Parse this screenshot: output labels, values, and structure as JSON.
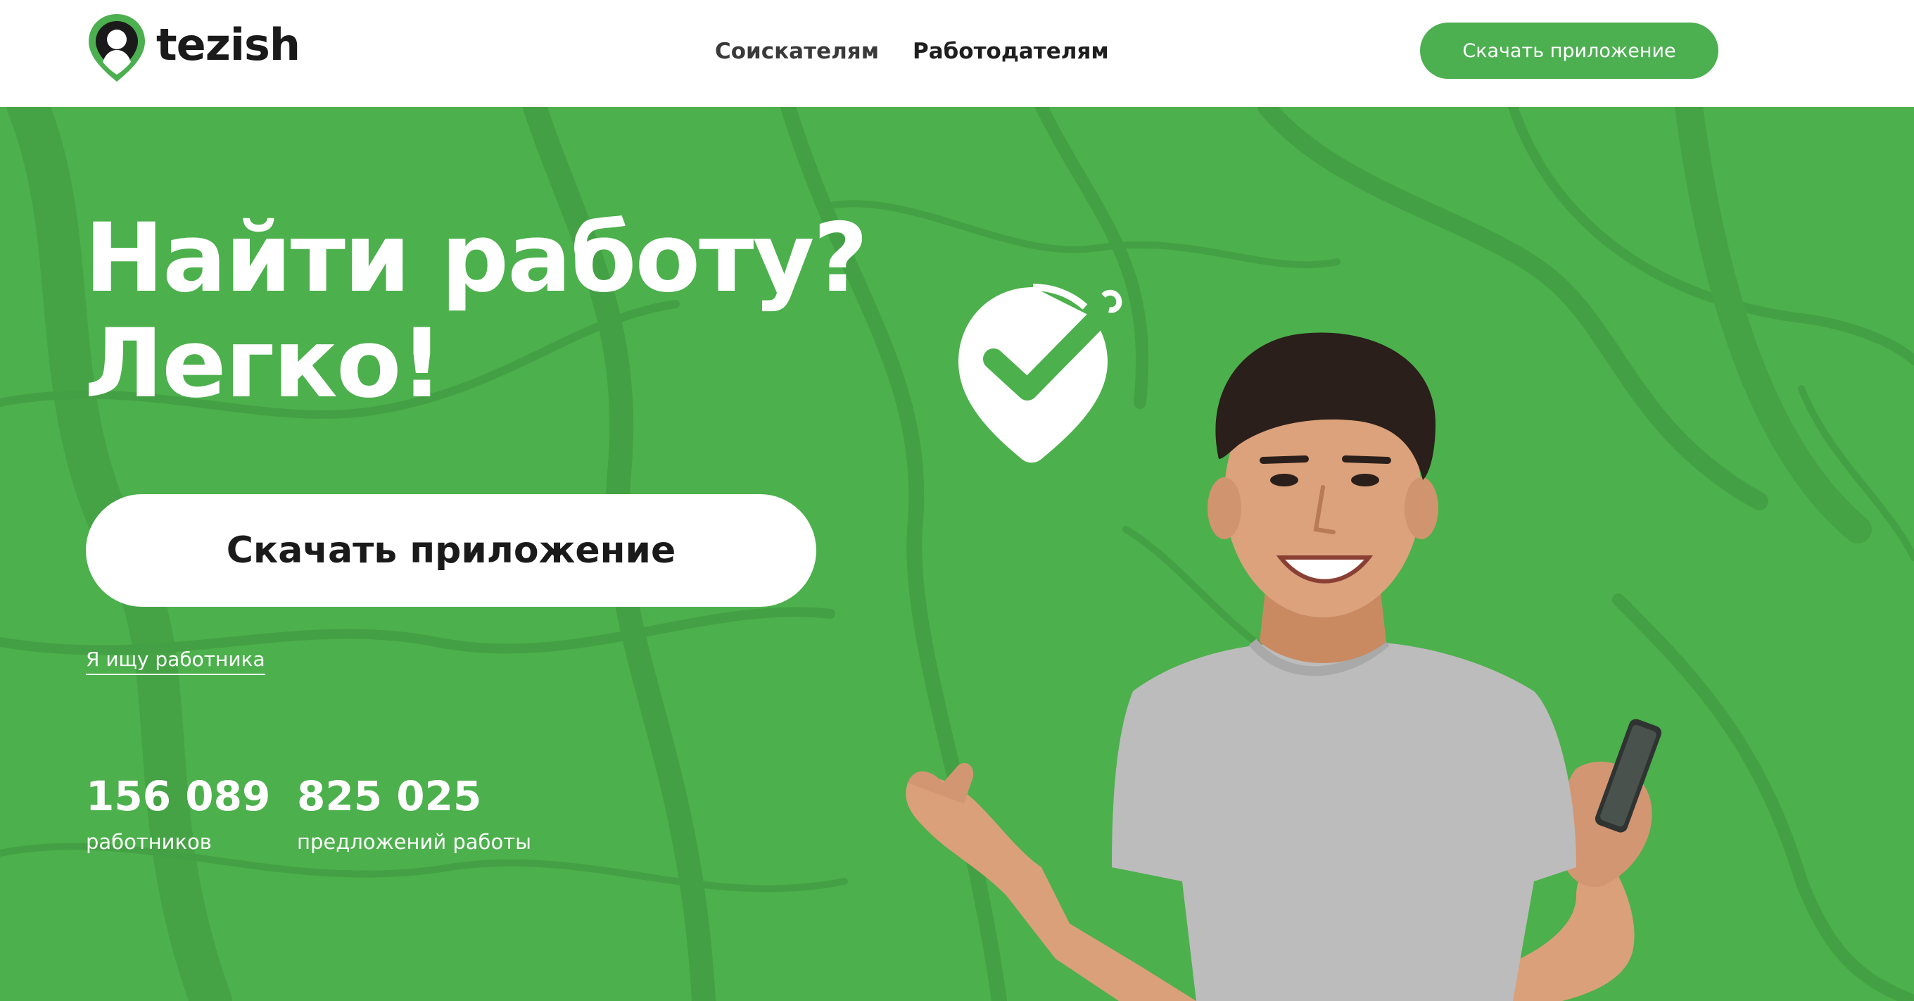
{
  "header": {
    "logo_text": "tezish",
    "nav": [
      {
        "label": "Соискателям"
      },
      {
        "label": "Работодателям"
      }
    ],
    "download_button": "Скачать приложение"
  },
  "hero": {
    "title_line1": "Найти работу?",
    "title_line2": "Легко!",
    "download_button": "Скачать приложение",
    "employer_link": "Я ищу работника",
    "stats": [
      {
        "value": "156 089",
        "label": "работников"
      },
      {
        "value": "825 025",
        "label": "предложений работы"
      }
    ]
  },
  "colors": {
    "brand_green": "#4caf50",
    "hero_bg": "#4cb04c",
    "text_dark": "#1a1a1a"
  },
  "icons": [
    "tezish-logo-icon",
    "location-check-icon"
  ]
}
